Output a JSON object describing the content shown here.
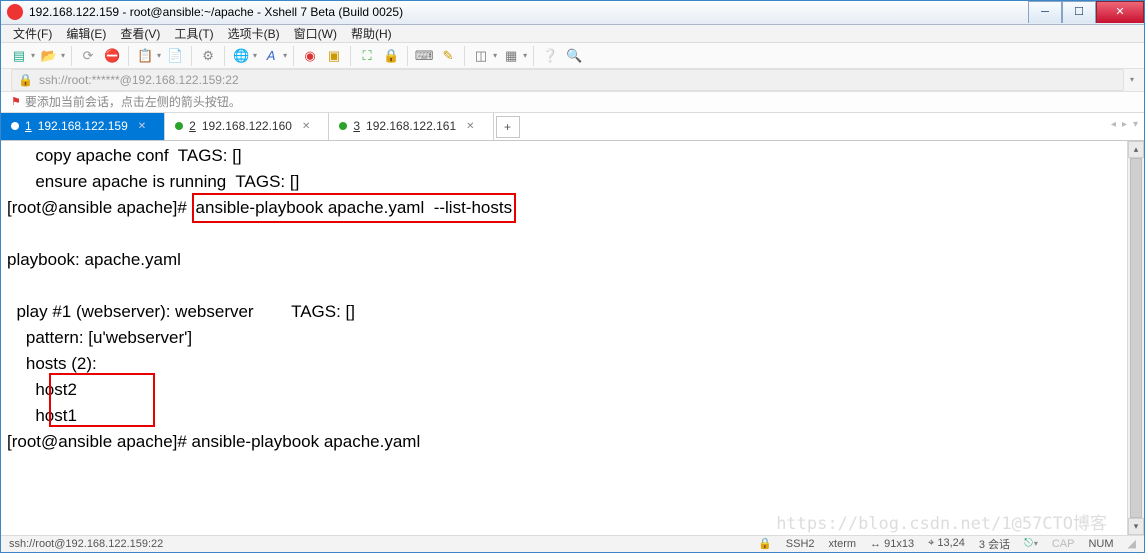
{
  "window": {
    "title": "192.168.122.159 - root@ansible:~/apache - Xshell 7 Beta (Build 0025)"
  },
  "menubar": [
    "文件(F)",
    "编辑(E)",
    "查看(V)",
    "工具(T)",
    "选项卡(B)",
    "窗口(W)",
    "帮助(H)"
  ],
  "address": "ssh://root:******@192.168.122.159:22",
  "infobar": "要添加当前会话，点击左侧的箭头按钮。",
  "tabs": [
    {
      "num": "1",
      "label": "192.168.122.159",
      "active": true
    },
    {
      "num": "2",
      "label": "192.168.122.160",
      "active": false
    },
    {
      "num": "3",
      "label": "192.168.122.161",
      "active": false
    }
  ],
  "terminal": {
    "l1": "      copy apache conf  TAGS: []",
    "l2": "      ensure apache is running  TAGS: []",
    "l3_prompt": "[root@ansible apache]# ",
    "l3_cmd": "ansible-playbook apache.yaml  --list-hosts",
    "l4": "",
    "l5": "playbook: apache.yaml",
    "l6": "",
    "l7": "  play #1 (webserver): webserver        TAGS: []",
    "l8": "    pattern: [u'webserver']",
    "l9": "    hosts (2):",
    "l10": "      host2",
    "l11": "      host1",
    "l12_prompt": "[root@ansible apache]# ",
    "l12_cmd": "ansible-playbook apache.yaml",
    "watermark": "https://blog.csdn.net/1@57CTO博客"
  },
  "statusbar": {
    "path": "ssh://root@192.168.122.159:22",
    "proto": "SSH2",
    "enc": "xterm",
    "size": "91x13",
    "pos": "13,24",
    "sess": "3 会话",
    "cap": "CAP",
    "num": "NUM"
  }
}
